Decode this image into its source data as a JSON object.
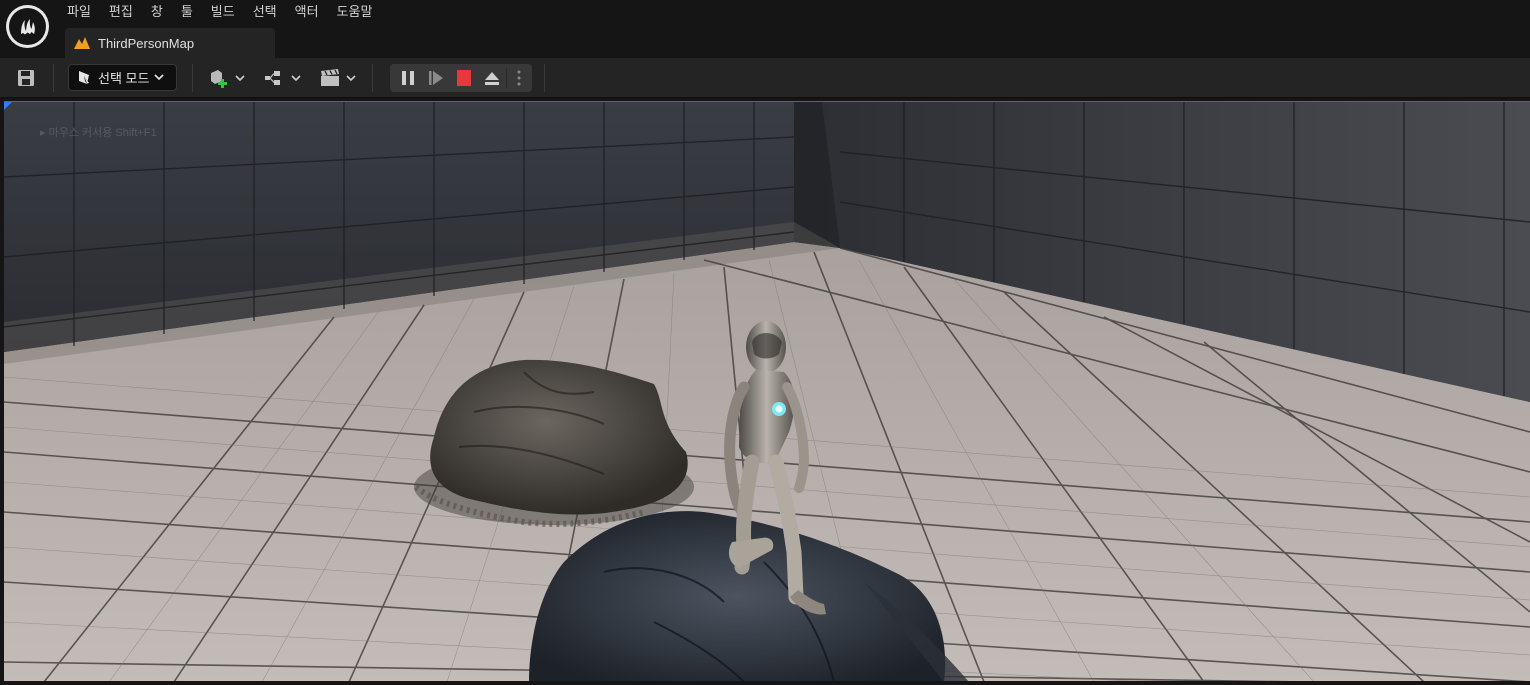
{
  "menu": {
    "items": [
      "파일",
      "편집",
      "창",
      "툴",
      "빌드",
      "선택",
      "액터",
      "도움말"
    ]
  },
  "tab": {
    "label": "ThirdPersonMap"
  },
  "toolbar": {
    "mode_label": "선택 모드"
  },
  "viewport": {
    "hint_text": "▸ 마우스 커서용 Shift+F1"
  },
  "colors": {
    "accent": "#2d7fff",
    "stop": "#e8383d",
    "tab_icon": "#f0a020"
  },
  "icons": {
    "logo": "unreal-engine-logo",
    "save": "save-icon",
    "mode": "select-mode-icon",
    "add_actor": "add-actor-icon",
    "blueprint": "blueprint-icon",
    "cinematics": "cinematics-icon",
    "pause": "pause-icon",
    "step": "frame-skip-icon",
    "stop": "stop-icon",
    "eject": "eject-icon",
    "more": "more-options-icon"
  }
}
